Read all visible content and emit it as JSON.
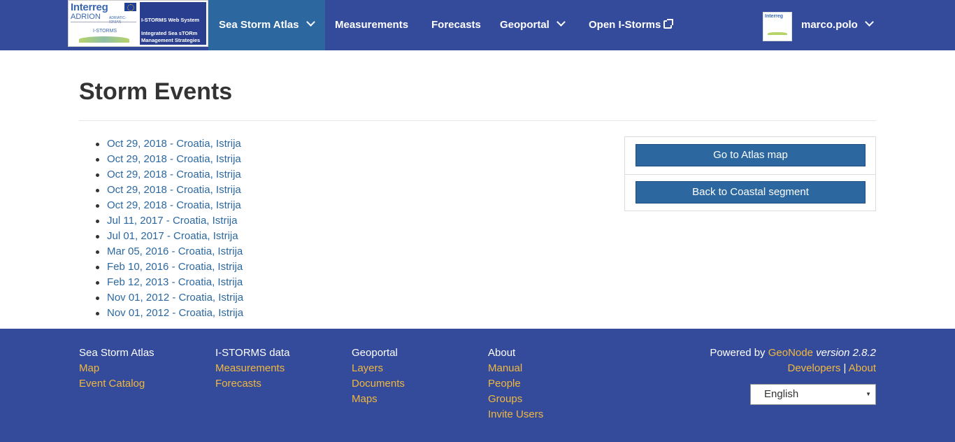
{
  "navbar": {
    "logo": {
      "left_brand": "Interreg",
      "left_program": "ADRION",
      "left_program_sub": "ADRIATIC-IONIAN",
      "left_project": "I-STORMS",
      "right_line1": "I-STORMS Web System",
      "right_line2": "Integrated Sea sTORm",
      "right_line3": "Management Strategies"
    },
    "items": [
      {
        "label": "Sea Storm Atlas",
        "dropdown": true,
        "active": true
      },
      {
        "label": "Measurements",
        "dropdown": false
      },
      {
        "label": "Forecasts",
        "dropdown": false
      },
      {
        "label": "Geoportal",
        "dropdown": true
      },
      {
        "label": "Open I-Storms",
        "external": true
      }
    ],
    "user": {
      "avatar_brand": "Interreg",
      "name": "marco.polo"
    },
    "colors": {
      "bar": "#344a9a",
      "active": "#2c689f"
    }
  },
  "main": {
    "title": "Storm Events",
    "events": [
      "Oct 29, 2018 - Croatia, Istrija",
      "Oct 29, 2018 - Croatia, Istrija",
      "Oct 29, 2018 - Croatia, Istrija",
      "Oct 29, 2018 - Croatia, Istrija",
      "Oct 29, 2018 - Croatia, Istrija",
      "Jul 11, 2017 - Croatia, Istrija",
      "Jul 01, 2017 - Croatia, Istrija",
      "Mar 05, 2016 - Croatia, Istrija",
      "Feb 10, 2016 - Croatia, Istrija",
      "Feb 12, 2013 - Croatia, Istrija",
      "Nov 01, 2012 - Croatia, Istrija",
      "Nov 01, 2012 - Croatia, Istrija"
    ],
    "buttons": {
      "atlas": "Go to Atlas map",
      "coastal": "Back to Coastal segment"
    }
  },
  "footer": {
    "columns": [
      {
        "heading": "Sea Storm Atlas",
        "links": [
          "Map",
          "Event Catalog"
        ]
      },
      {
        "heading": "I-STORMS data",
        "links": [
          "Measurements",
          "Forecasts"
        ]
      },
      {
        "heading": "Geoportal",
        "links": [
          "Layers",
          "Documents",
          "Maps"
        ]
      },
      {
        "heading": "About",
        "links": [
          "Manual",
          "People",
          "Groups",
          "Invite Users"
        ]
      }
    ],
    "powered_prefix": "Powered by",
    "powered_link": "GeoNode",
    "version": "version 2.8.2",
    "developers": "Developers",
    "separator": "|",
    "about": "About",
    "language": "English",
    "link_color": "#f0b840"
  }
}
